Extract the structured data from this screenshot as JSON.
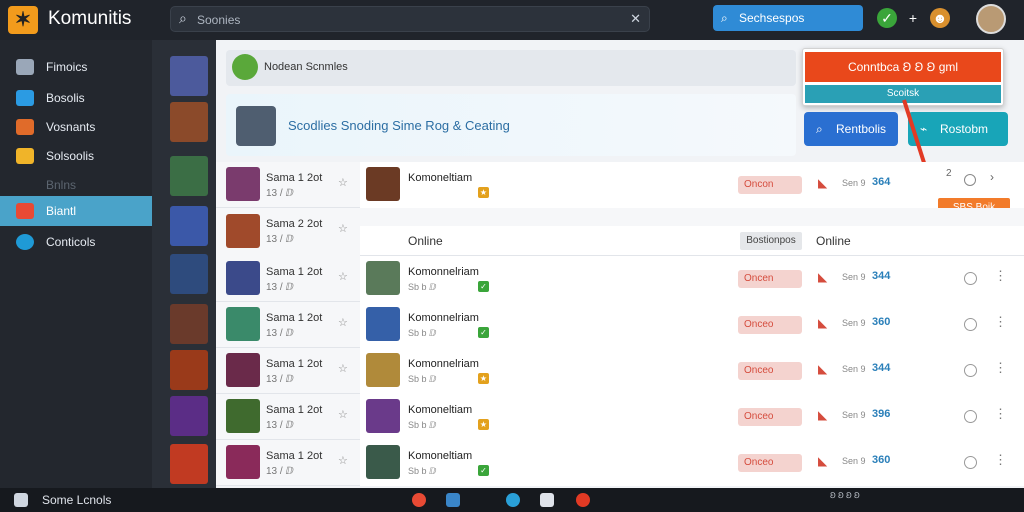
{
  "app": {
    "title": "Komunitis"
  },
  "search": {
    "placeholder": "Soonies",
    "clear_icon": "close-icon"
  },
  "top_button": {
    "label": "Sechsespos"
  },
  "sidebar": {
    "items": [
      {
        "label": "Fimoics",
        "color": "#9aa7b8"
      },
      {
        "label": "Bosolis",
        "color": "#2b9be3"
      },
      {
        "label": "Vosnants",
        "color": "#e06b2a"
      },
      {
        "label": "Solsoolis",
        "color": "#f0b429"
      },
      {
        "label": "Bnlns",
        "color": "#3a424c"
      },
      {
        "label": "Biantl",
        "color": "#e84a34"
      },
      {
        "label": "Conticols",
        "color": "#1f9ad6"
      }
    ]
  },
  "main": {
    "banner_title": "Nodean Scnmles",
    "hero_title": "Scodlies Snoding Sime Rog & Ceating",
    "popup": {
      "primary": "Conntbca Ꞝ Ꞝ Ꞝ gml",
      "secondary": "Scoitsk"
    },
    "action_buttons": [
      {
        "label": "Rentbolis",
        "color": "#2a6fd1"
      },
      {
        "label": "Rostobm",
        "color": "#18a5b8"
      }
    ],
    "callout": {
      "label": "SBS Boik",
      "page": "2"
    },
    "online_header": {
      "left": "Online",
      "tag": "Bostionpos",
      "right": "Online"
    },
    "rows": [
      {
        "n1": "Sama 1 2ot",
        "s1": "13 / ⅅ",
        "n2": "Komoneltiam",
        "s2": "",
        "status": "Oncon",
        "count": "364"
      },
      {
        "n1": "Sama 2 2ot",
        "s1": "13 / ⅅ",
        "n2": "",
        "s2": "",
        "status": "",
        "count": ""
      },
      {
        "n1": "Sama 1 2ot",
        "s1": "13 / ⅅ",
        "n2": "Komonnelriam",
        "s2": "Sb b ⅅ",
        "status": "Oncen",
        "count": "344"
      },
      {
        "n1": "Sama 1 2ot",
        "s1": "13 / ⅅ",
        "n2": "Komonnelriam",
        "s2": "Sb b ⅅ",
        "status": "Onceo",
        "count": "360"
      },
      {
        "n1": "Sama 1 2ot",
        "s1": "13 / ⅅ",
        "n2": "Komonnelriam",
        "s2": "Sb b ⅅ",
        "status": "Onceo",
        "count": "344"
      },
      {
        "n1": "Sama 1 2ot",
        "s1": "13 / ⅅ",
        "n2": "Komoneltiam",
        "s2": "Sb b ⅅ",
        "status": "Onceo",
        "count": "396"
      },
      {
        "n1": "Sama 1 2ot",
        "s1": "13 / ⅅ",
        "n2": "Komoneltiam",
        "s2": "Sb b ⅅ",
        "status": "Onceo",
        "count": "360"
      }
    ],
    "row_label": "Sen 9"
  },
  "taskbar": {
    "label": "Some Lcnols",
    "clock": "Ꞝ Ꞝ Ꞝ Ꞝ"
  }
}
